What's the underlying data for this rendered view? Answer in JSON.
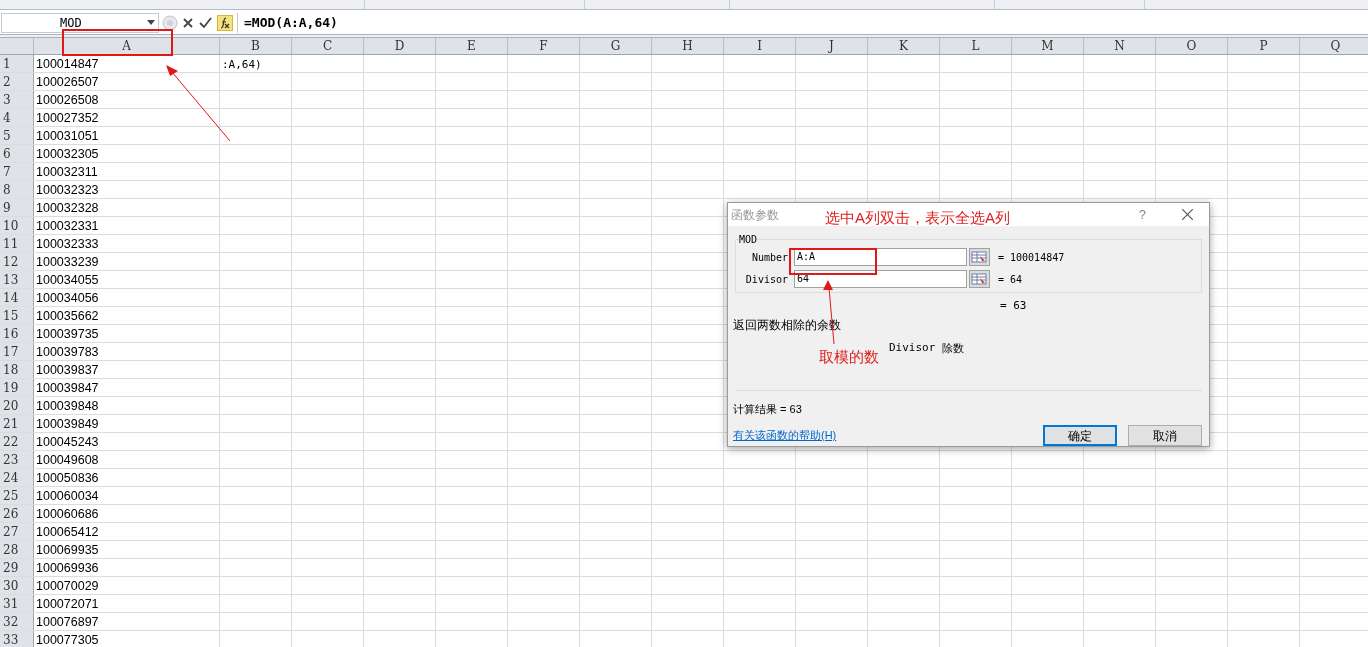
{
  "name_box": "MOD",
  "formula": "=MOD(A:A,64)",
  "columns": [
    "A",
    "B",
    "C",
    "D",
    "E",
    "F",
    "G",
    "H",
    "I",
    "J",
    "K",
    "L",
    "M",
    "N",
    "O",
    "P",
    "Q"
  ],
  "rows": [
    {
      "number": "1",
      "a": "100014847",
      "b": ":A,64)"
    },
    {
      "number": "2",
      "a": "100026507"
    },
    {
      "number": "3",
      "a": "100026508"
    },
    {
      "number": "4",
      "a": "100027352"
    },
    {
      "number": "5",
      "a": "100031051"
    },
    {
      "number": "6",
      "a": "100032305"
    },
    {
      "number": "7",
      "a": "100032311"
    },
    {
      "number": "8",
      "a": "100032323"
    },
    {
      "number": "9",
      "a": "100032328"
    },
    {
      "number": "10",
      "a": "100032331"
    },
    {
      "number": "11",
      "a": "100032333"
    },
    {
      "number": "12",
      "a": "100033239"
    },
    {
      "number": "13",
      "a": "100034055"
    },
    {
      "number": "14",
      "a": "100034056"
    },
    {
      "number": "15",
      "a": "100035662"
    },
    {
      "number": "16",
      "a": "100039735"
    },
    {
      "number": "17",
      "a": "100039783"
    },
    {
      "number": "18",
      "a": "100039837"
    },
    {
      "number": "19",
      "a": "100039847"
    },
    {
      "number": "20",
      "a": "100039848"
    },
    {
      "number": "21",
      "a": "100039849"
    },
    {
      "number": "22",
      "a": "100045243"
    },
    {
      "number": "23",
      "a": "100049608"
    },
    {
      "number": "24",
      "a": "100050836"
    },
    {
      "number": "25",
      "a": "100060034"
    },
    {
      "number": "26",
      "a": "100060686"
    },
    {
      "number": "27",
      "a": "100065412"
    },
    {
      "number": "28",
      "a": "100069935"
    },
    {
      "number": "29",
      "a": "100069936"
    },
    {
      "number": "30",
      "a": "100070029"
    },
    {
      "number": "31",
      "a": "100072071"
    },
    {
      "number": "32",
      "a": "100076897"
    },
    {
      "number": "33",
      "a": "100077305"
    }
  ],
  "dialog": {
    "title": "函数参数",
    "help": "?",
    "function_name": "MOD",
    "arguments": [
      {
        "label": "Number",
        "value": "A:A",
        "result": "= 100014847"
      },
      {
        "label": "Divisor",
        "value": "64",
        "result": "= 64"
      }
    ],
    "result": "= 63",
    "description": "返回两数相除的余数",
    "argument_name": "Divisor",
    "argument_help": "除数",
    "formula_result": "计算结果 = 63",
    "help_link": "有关该函数的帮助(H)",
    "buttons": [
      {
        "label": "确定",
        "selected": true
      },
      {
        "label": "取消",
        "selected": false
      }
    ]
  },
  "annotations": [
    {
      "text": "选中A列双击，表示全选A列"
    },
    {
      "text": "取模的数"
    }
  ]
}
